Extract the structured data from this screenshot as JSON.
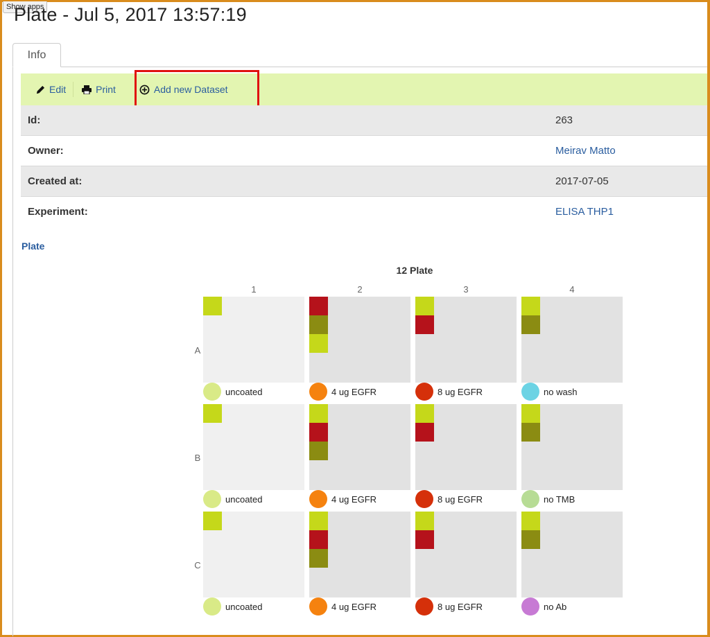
{
  "app": {
    "show_apps": "Show apps"
  },
  "page": {
    "title": "Plate - Jul 5, 2017 13:57:19"
  },
  "tabs": [
    {
      "label": "Info",
      "active": true
    }
  ],
  "toolbar": {
    "edit": {
      "label": "Edit",
      "icon": "pencil-icon"
    },
    "print": {
      "label": "Print",
      "icon": "printer-icon"
    },
    "add_dataset": {
      "label": "Add new Dataset",
      "icon": "plus-circle-icon"
    }
  },
  "info": {
    "id": {
      "label": "Id:",
      "value": "263"
    },
    "owner": {
      "label": "Owner:",
      "value": "Meirav Matto"
    },
    "created": {
      "label": "Created at:",
      "value": "2017-07-05"
    },
    "experiment": {
      "label": "Experiment:",
      "value": "ELISA THP1"
    }
  },
  "section": {
    "plate_link": "Plate"
  },
  "plate": {
    "title": "12 Plate",
    "columns": [
      "1",
      "2",
      "3",
      "4"
    ],
    "rows": [
      "A",
      "B",
      "C"
    ],
    "colors": {
      "lime": "#c5d81a",
      "red": "#b5121b",
      "olive": "#8b8c12"
    },
    "wells": [
      {
        "label": "uncoated",
        "dot": "#d9ea87",
        "squares": [
          "lime"
        ]
      },
      {
        "label": "4 ug EGFR",
        "dot": "#f5820f",
        "squares": [
          "red",
          "olive",
          "lime"
        ]
      },
      {
        "label": "8 ug EGFR",
        "dot": "#d5300a",
        "squares": [
          "lime",
          "red"
        ]
      },
      {
        "label": "no wash",
        "dot": "#6cd3e4",
        "squares": [
          "lime",
          "olive"
        ]
      },
      {
        "label": "uncoated",
        "dot": "#d9ea87",
        "squares": [
          "lime"
        ]
      },
      {
        "label": "4 ug EGFR",
        "dot": "#f5820f",
        "squares": [
          "lime",
          "red",
          "olive"
        ]
      },
      {
        "label": "8 ug EGFR",
        "dot": "#d5300a",
        "squares": [
          "lime",
          "red"
        ]
      },
      {
        "label": "no TMB",
        "dot": "#b7dc95",
        "squares": [
          "lime",
          "olive"
        ]
      },
      {
        "label": "uncoated",
        "dot": "#d9ea87",
        "squares": [
          "lime"
        ]
      },
      {
        "label": "4 ug EGFR",
        "dot": "#f5820f",
        "squares": [
          "lime",
          "red",
          "olive"
        ]
      },
      {
        "label": "8 ug EGFR",
        "dot": "#d5300a",
        "squares": [
          "lime",
          "red"
        ]
      },
      {
        "label": "no Ab",
        "dot": "#c77ad4",
        "squares": [
          "lime",
          "olive"
        ]
      }
    ]
  }
}
